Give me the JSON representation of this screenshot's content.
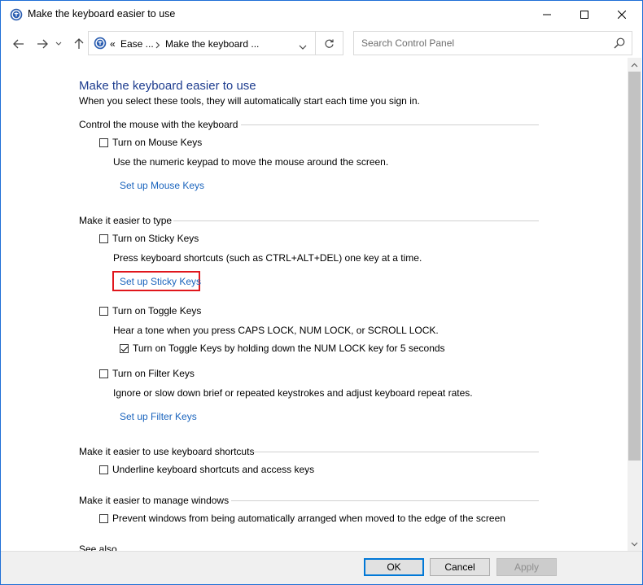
{
  "window": {
    "title": "Make the keyboard easier to use",
    "icon": "ease-of-access-icon"
  },
  "nav": {
    "breadcrumbs": [
      "«",
      "Ease ...",
      "Make the keyboard ..."
    ],
    "search_placeholder": "Search Control Panel"
  },
  "page": {
    "heading": "Make the keyboard easier to use",
    "subtitle": "When you select these tools, they will automatically start each time you sign in."
  },
  "mouse_section": {
    "title": "Control the mouse with the keyboard",
    "option": "Turn on Mouse Keys",
    "option_checked": false,
    "desc": "Use the numeric keypad to move the mouse around the screen.",
    "link": "Set up Mouse Keys"
  },
  "typing_section": {
    "title": "Make it easier to type",
    "sticky": {
      "label": "Turn on Sticky Keys",
      "checked": false,
      "desc": "Press keyboard shortcuts (such as CTRL+ALT+DEL) one key at a time.",
      "link": "Set up Sticky Keys"
    },
    "toggle": {
      "label": "Turn on Toggle Keys",
      "checked": false,
      "desc": "Hear a tone when you press CAPS LOCK, NUM LOCK, or SCROLL LOCK.",
      "sub_option": "Turn on Toggle Keys by holding down the NUM LOCK key for 5 seconds",
      "sub_checked": true
    },
    "filter": {
      "label": "Turn on Filter Keys",
      "checked": false,
      "desc": "Ignore or slow down brief or repeated keystrokes and adjust keyboard repeat rates.",
      "link": "Set up Filter Keys"
    }
  },
  "shortcuts_section": {
    "title": "Make it easier to use keyboard shortcuts",
    "option": "Underline keyboard shortcuts and access keys",
    "option_checked": false
  },
  "windows_section": {
    "title": "Make it easier to manage windows",
    "option": "Prevent windows from being automatically arranged when moved to the edge of the screen",
    "option_checked": false
  },
  "see_also": "See also",
  "buttons": {
    "ok": "OK",
    "cancel": "Cancel",
    "apply": "Apply"
  },
  "colors": {
    "heading": "#1e3d8f",
    "link": "#1a64bd",
    "highlight": "#e0161c",
    "window_border": "#1e6fd6"
  }
}
